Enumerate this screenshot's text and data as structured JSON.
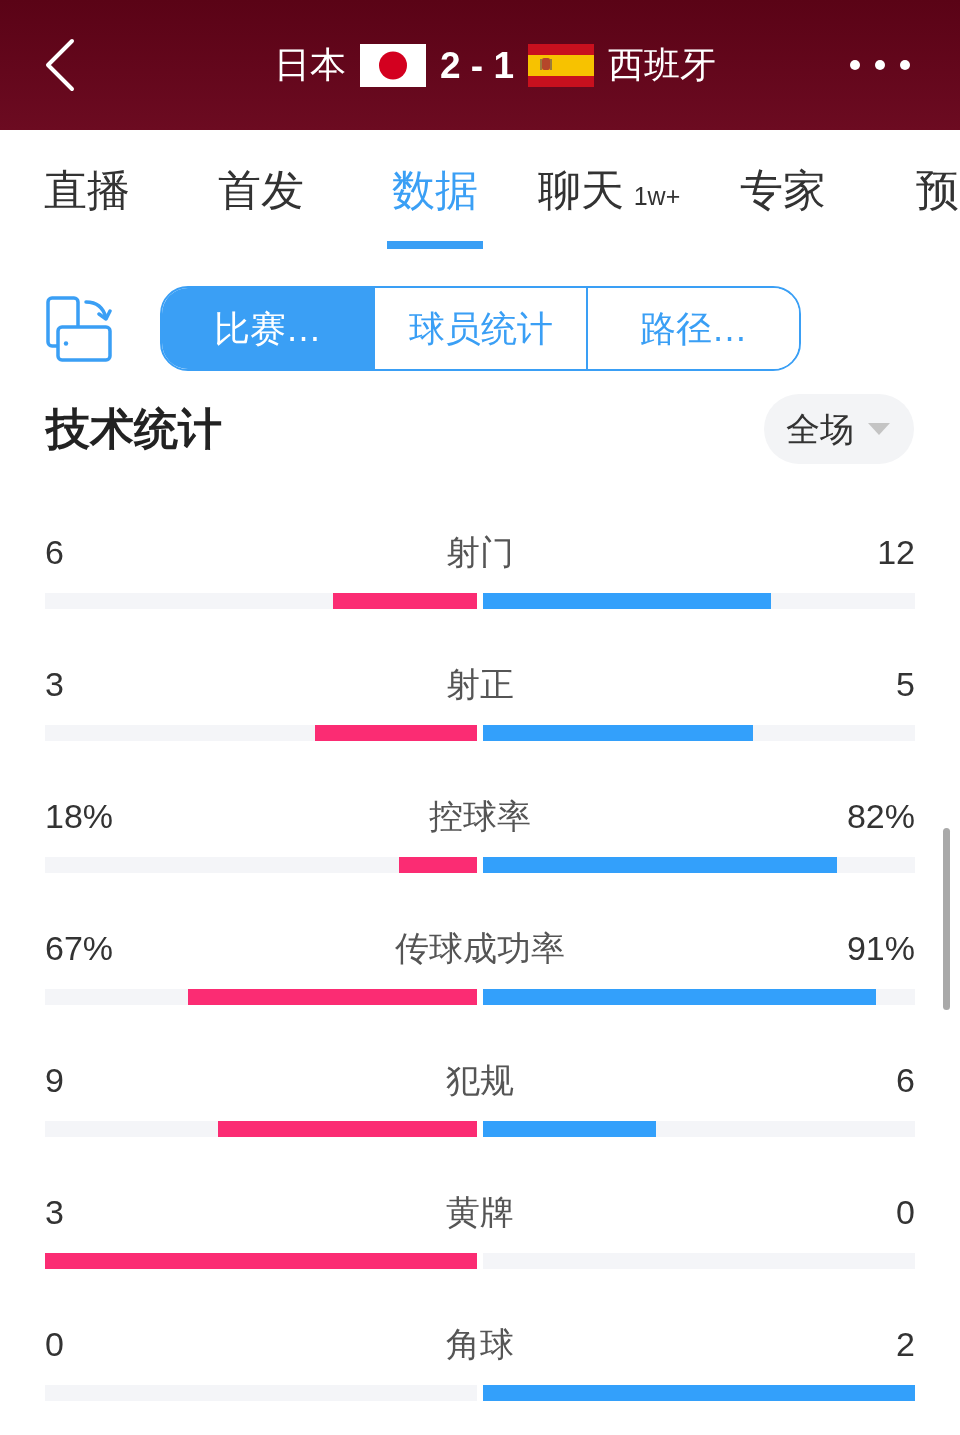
{
  "header": {
    "home_team": "日本",
    "score": "2 - 1",
    "away_team": "西班牙"
  },
  "tabs": [
    {
      "label": "直播",
      "selected": false
    },
    {
      "label": "首发",
      "selected": false
    },
    {
      "label": "数据",
      "selected": true
    },
    {
      "label": "聊天",
      "badge": "1w+",
      "selected": false
    },
    {
      "label": "专家",
      "selected": false
    },
    {
      "label": "预",
      "selected": false
    }
  ],
  "segments": [
    {
      "label": "比赛…",
      "selected": true
    },
    {
      "label": "球员统计",
      "selected": false
    },
    {
      "label": "路径…",
      "selected": false
    }
  ],
  "section": {
    "title": "技术统计",
    "filter": "全场"
  },
  "stats": [
    {
      "label": "射门",
      "home": {
        "value": "6",
        "level": 0.333
      },
      "away": {
        "value": "12",
        "level": 0.667
      }
    },
    {
      "label": "射正",
      "home": {
        "value": "3",
        "level": 0.375
      },
      "away": {
        "value": "5",
        "level": 0.625
      }
    },
    {
      "label": "控球率",
      "home": {
        "value": "18%",
        "level": 0.18
      },
      "away": {
        "value": "82%",
        "level": 0.82
      }
    },
    {
      "label": "传球成功率",
      "home": {
        "value": "67%",
        "level": 0.67
      },
      "away": {
        "value": "91%",
        "level": 0.91
      }
    },
    {
      "label": "犯规",
      "home": {
        "value": "9",
        "level": 0.6
      },
      "away": {
        "value": "6",
        "level": 0.4
      }
    },
    {
      "label": "黄牌",
      "home": {
        "value": "3",
        "level": 1
      },
      "away": {
        "value": "0",
        "level": 0
      }
    },
    {
      "label": "角球",
      "home": {
        "value": "0",
        "level": 0
      },
      "away": {
        "value": "2",
        "level": 1
      }
    }
  ]
}
